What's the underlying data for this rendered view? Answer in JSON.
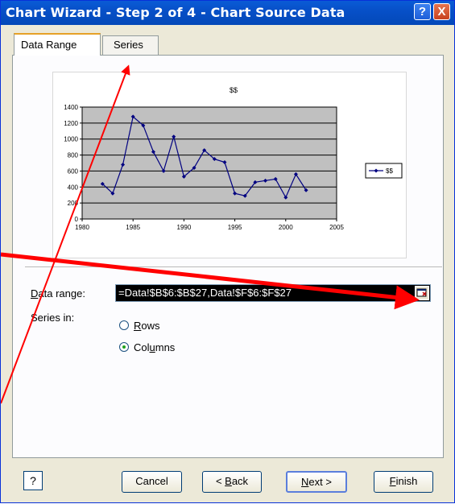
{
  "window": {
    "title": "Chart Wizard - Step 2 of 4 - Chart Source Data",
    "help_glyph": "?",
    "close_glyph": "X"
  },
  "tabs": [
    {
      "label": "Data Range",
      "active": true
    },
    {
      "label": "Series",
      "active": false
    }
  ],
  "chart_data": {
    "type": "line",
    "title": "$$",
    "xlabel": "",
    "ylabel": "",
    "xlim": [
      1980,
      2005
    ],
    "ylim": [
      0,
      1400
    ],
    "x_ticks": [
      "1980",
      "1985",
      "1990",
      "1995",
      "2000",
      "2005"
    ],
    "y_ticks": [
      "0",
      "200",
      "400",
      "600",
      "800",
      "1000",
      "1200",
      "1400"
    ],
    "grid": true,
    "legend_position": "right",
    "series": [
      {
        "name": "$$",
        "color": "#000080",
        "x": [
          1982,
          1983,
          1984,
          1985,
          1986,
          1987,
          1988,
          1989,
          1990,
          1991,
          1992,
          1993,
          1994,
          1995,
          1996,
          1997,
          1998,
          1999,
          2000,
          2001,
          2002
        ],
        "y": [
          440,
          320,
          680,
          1280,
          1170,
          840,
          600,
          1030,
          530,
          640,
          860,
          750,
          710,
          320,
          290,
          460,
          480,
          500,
          270,
          560,
          360
        ]
      }
    ],
    "plot_background": "#c0c0c0"
  },
  "form": {
    "data_range_label": "Data range:",
    "data_range_value": "=Data!$B$6:$B$27,Data!$F$6:$F$27",
    "series_in_label": "Series in:",
    "rows_label": "Rows",
    "columns_label": "Columns",
    "selected": "Columns"
  },
  "buttons": {
    "help_glyph": "?",
    "cancel": "Cancel",
    "back_prefix": "< ",
    "back_key": "B",
    "back_rest": "ack",
    "next_key": "N",
    "next_rest": "ext >",
    "finish_key": "F",
    "finish_rest": "inish"
  },
  "annotations": {
    "arrow_color": "#ff0000"
  }
}
